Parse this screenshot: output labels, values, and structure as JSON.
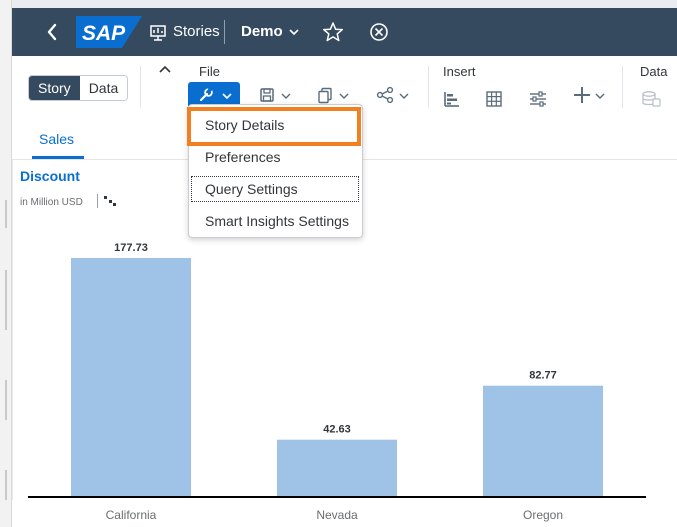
{
  "shell": {
    "logo_text": "SAP",
    "stories_label": "Stories",
    "story_name": "Demo",
    "colors": {
      "bar": "#354a5f",
      "logo": "#0a6ed1"
    }
  },
  "toolbar": {
    "mode_tabs": [
      {
        "label": "Story",
        "active": true
      },
      {
        "label": "Data",
        "active": false
      }
    ],
    "groups": {
      "file": "File",
      "insert": "Insert",
      "data": "Data"
    },
    "icons": [
      "collapse-chevron-up-icon",
      "wrench-icon",
      "save-icon",
      "copy-icon",
      "share-icon",
      "chart-icon",
      "table-icon",
      "filter-icon",
      "add-icon",
      "data-source-icon"
    ]
  },
  "tabs": [
    {
      "label": "Sales",
      "active": true
    }
  ],
  "file_menu": {
    "items": [
      {
        "label": "Story Details",
        "highlighted": true
      },
      {
        "label": "Preferences"
      },
      {
        "label": "Query Settings",
        "focused": true
      },
      {
        "label": "Smart Insights Settings"
      }
    ],
    "highlight_color": "#f28020"
  },
  "chart_data": {
    "type": "bar",
    "title": "Discount",
    "subtitle": "in Million USD",
    "categories": [
      "California",
      "Nevada",
      "Oregon"
    ],
    "values": [
      177.73,
      42.63,
      82.77
    ],
    "data_labels": [
      "177.73",
      "42.63",
      "82.77"
    ],
    "ylim": [
      0,
      200
    ],
    "bar_color": "#9fc3e7",
    "grid": false,
    "legend": "none"
  }
}
